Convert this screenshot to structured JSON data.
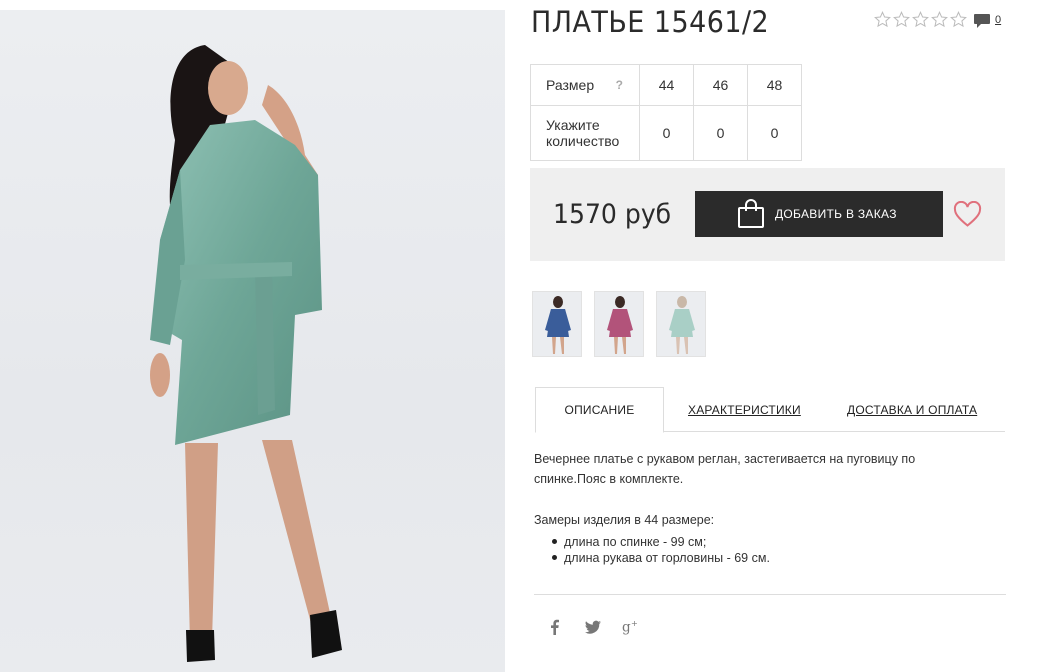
{
  "product": {
    "title": "ПЛАТЬЕ 15461/2",
    "rating": {
      "value": 0,
      "max": 5
    },
    "comments_count": "0"
  },
  "size_table": {
    "size_label": "Размер",
    "help_symbol": "?",
    "sizes": [
      "44",
      "46",
      "48"
    ],
    "quantity_label": "Укажите количество",
    "quantities": [
      "0",
      "0",
      "0"
    ]
  },
  "purchase": {
    "price": "1570 руб",
    "order_button": "ДОБАВИТЬ В ЗАКАЗ",
    "button_color": "#2b2b2b",
    "wishlist_color": "#e0707c"
  },
  "thumbnails": [
    {
      "name": "thumb-blue-dress",
      "color": "#3a5d9a"
    },
    {
      "name": "thumb-pink-dress",
      "color": "#b2537a"
    },
    {
      "name": "thumb-mint-dress",
      "color": "#a9cfc6"
    }
  ],
  "tabs": [
    {
      "label": "ОПИСАНИЕ",
      "active": true
    },
    {
      "label": "ХАРАКТЕРИСТИКИ",
      "active": false
    },
    {
      "label": "ДОСТАВКА И ОПЛАТА",
      "active": false
    }
  ],
  "description": {
    "text": "Вечернее платье с рукавом реглан, застегивается на пуговицу по спинке.Пояс в комплекте.",
    "measures_title": "Замеры изделия в 44 размере:",
    "measures": [
      "длина по спинке - 99 см;",
      "длина рукава от горловины - 69 см."
    ]
  },
  "social": [
    "facebook-icon",
    "twitter-icon",
    "google-plus-icon"
  ]
}
